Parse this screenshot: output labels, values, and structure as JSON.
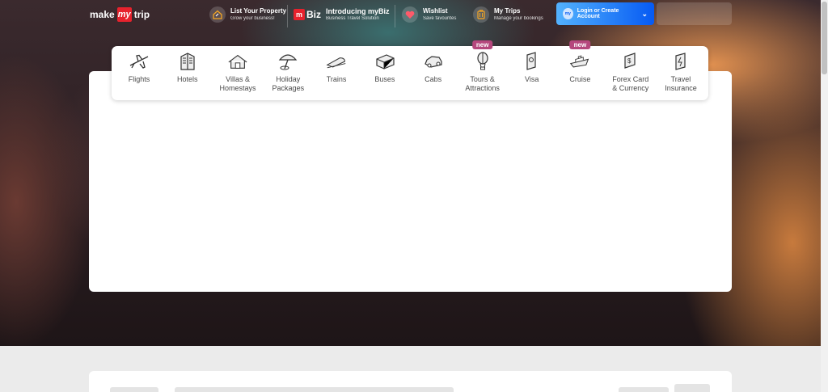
{
  "header": {
    "logo": {
      "left": "make",
      "mark": "my",
      "right": "trip"
    },
    "list_property": {
      "title": "List Your Property",
      "subtitle": "Grow your business!"
    },
    "mybiz": {
      "badge": "Biz",
      "title": "Introducing myBiz",
      "subtitle": "Business Travel Solution"
    },
    "wishlist": {
      "title": "Wishlist",
      "subtitle": "Save favourites"
    },
    "my_trips": {
      "title": "My Trips",
      "subtitle": "Manage your bookings"
    },
    "login": {
      "badge": "my",
      "label": "Login or Create Account"
    }
  },
  "nav": {
    "items": [
      {
        "label": "Flights",
        "icon": "flight-icon"
      },
      {
        "label": "Hotels",
        "icon": "hotel-icon"
      },
      {
        "label": "Villas &\nHomestays",
        "icon": "villa-icon"
      },
      {
        "label": "Holiday\nPackages",
        "icon": "holiday-icon"
      },
      {
        "label": "Trains",
        "icon": "train-icon"
      },
      {
        "label": "Buses",
        "icon": "bus-icon"
      },
      {
        "label": "Cabs",
        "icon": "cab-icon"
      },
      {
        "label": "Tours &\nAttractions",
        "icon": "balloon-icon",
        "badge": "new"
      },
      {
        "label": "Visa",
        "icon": "passport-icon"
      },
      {
        "label": "Cruise",
        "icon": "cruise-icon",
        "badge": "new"
      },
      {
        "label": "Forex Card\n& Currency",
        "icon": "forex-icon"
      },
      {
        "label": "Travel\nInsurance",
        "icon": "insurance-icon"
      }
    ]
  },
  "colors": {
    "brand_red": "#e7222d",
    "login_blue": "#065af3",
    "new_badge": "#b5477d"
  }
}
